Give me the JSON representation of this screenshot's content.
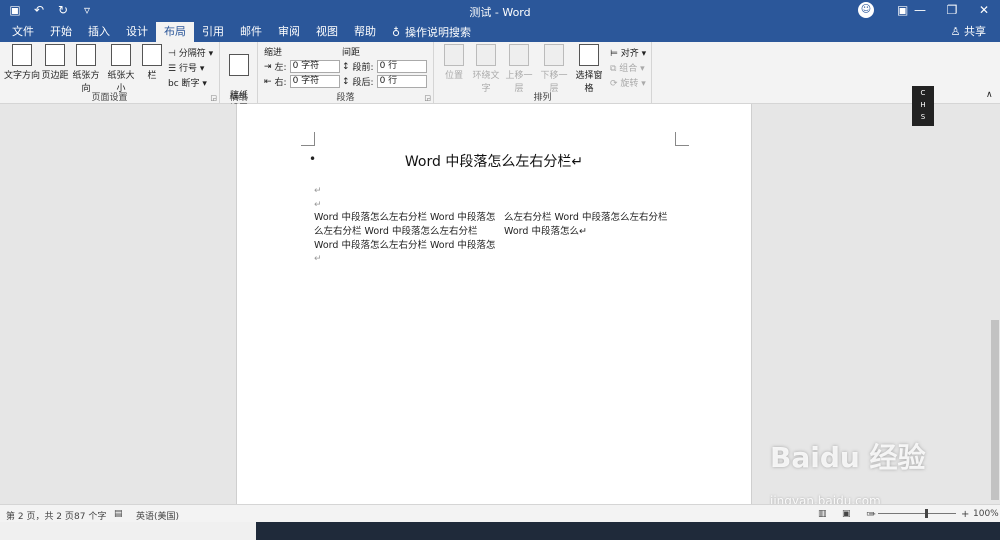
{
  "titlebar": {
    "title": "测试 - Word",
    "qat": [
      "save-icon",
      "undo-icon",
      "redo-icon",
      "customize-icon"
    ],
    "ribbon_options": "▣",
    "window_controls": [
      "—",
      "❐",
      "✕"
    ]
  },
  "tabs": [
    {
      "label": "文件",
      "active": false
    },
    {
      "label": "开始",
      "active": false
    },
    {
      "label": "插入",
      "active": false
    },
    {
      "label": "设计",
      "active": false
    },
    {
      "label": "布局",
      "active": true
    },
    {
      "label": "引用",
      "active": false
    },
    {
      "label": "邮件",
      "active": false
    },
    {
      "label": "审阅",
      "active": false
    },
    {
      "label": "视图",
      "active": false
    },
    {
      "label": "帮助",
      "active": false
    }
  ],
  "tellme": "操作说明搜索",
  "share": "共享",
  "ribbon": {
    "page_setup": {
      "label": "页面设置",
      "text_direction": "文字方向",
      "margins": "页边距",
      "orientation": "纸张方向",
      "size": "纸张大小",
      "columns": "栏",
      "breaks": "分隔符",
      "line_numbers": "行号",
      "hyphenation": "断字"
    },
    "manuscript": {
      "label": "稿纸",
      "button": "稿纸\n设置"
    },
    "paragraph": {
      "label": "段落",
      "indent": "缩进",
      "spacing": "间距",
      "left_label": "左:",
      "left_value": "0 字符",
      "right_label": "右:",
      "right_value": "0 字符",
      "before_label": "段前:",
      "before_value": "0 行",
      "after_label": "段后:",
      "after_value": "0 行"
    },
    "arrange": {
      "label": "排列",
      "position": "位置",
      "wrap": "环绕文字",
      "forward": "上移一层",
      "backward": "下移一层",
      "selection_pane": "选择窗格",
      "align": "对齐",
      "group": "组合",
      "rotate": "旋转"
    }
  },
  "document": {
    "title": "Word 中段落怎么左右分栏↵",
    "col_left": [
      "Word 中段落怎么左右分栏 Word 中段落怎",
      "么左右分栏  Word  中段落怎么左右分栏",
      "Word 中段落怎么左右分栏 Word 中段落怎"
    ],
    "col_right": [
      "么左右分栏  Word  中段落怎么左右分栏",
      "Word 中段落怎么↵"
    ],
    "para_mark": "↵"
  },
  "ime": [
    "C",
    "H",
    "S",
    "C"
  ],
  "statusbar": {
    "page": "第 2 页，共 2 页",
    "words": "87 个字",
    "language": "英语(美国)",
    "zoom_minus": "−",
    "zoom_plus": "+",
    "zoom": "100%"
  },
  "watermark": {
    "text": "Baidu 经验",
    "url": "jingyan.baidu.com"
  }
}
